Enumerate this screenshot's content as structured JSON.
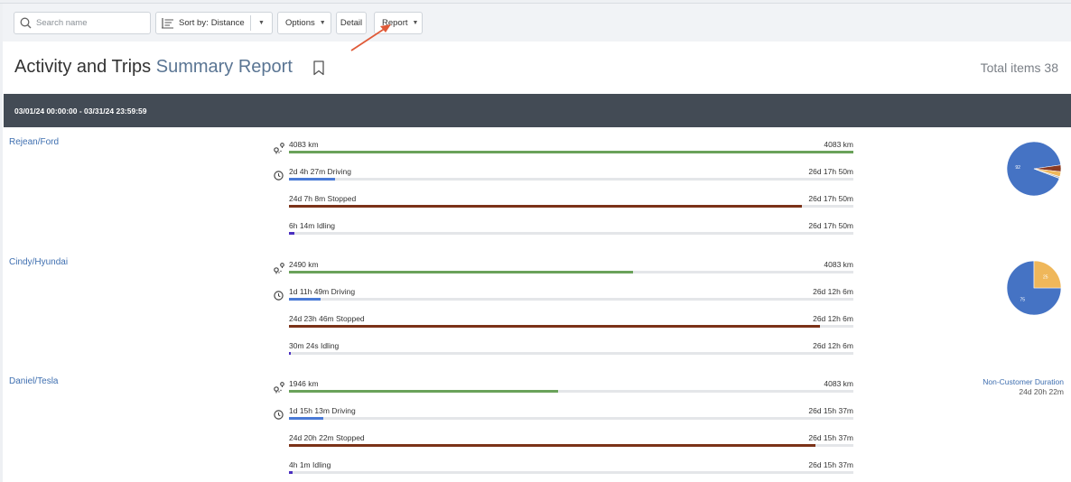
{
  "toolbar": {
    "search_placeholder": "Search name",
    "sort_label": "Sort by:",
    "sort_value": "Distance",
    "options_label": "Options",
    "detail_label": "Detail",
    "report_label": "Report"
  },
  "header": {
    "title_main": "Activity and Trips",
    "title_accent": "Summary Report",
    "total_label": "Total items 38"
  },
  "date_range": "03/01/24 00:00:00 - 03/31/24 23:59:59",
  "colors": {
    "distance": "#6aa25a",
    "driving": "#4a7ad6",
    "stopped": "#7b3218",
    "idling": "#4a2fc0",
    "pie_blue": "#4573c4",
    "pie_orange": "#efb75a",
    "pie_brown": "#8a3a22",
    "pie_gray": "#b0b4bb"
  },
  "items": [
    {
      "name": "Rejean/Ford",
      "metrics": [
        {
          "label": "4083 km",
          "total": "4083 km",
          "fraction": 1.0
        },
        {
          "label": "2d 4h 27m Driving",
          "total": "26d 17h 50m",
          "fraction": 0.082
        },
        {
          "label": "24d 7h 8m Stopped",
          "total": "26d 17h 50m",
          "fraction": 0.908
        },
        {
          "label": "6h 14m Idling",
          "total": "26d 17h 50m",
          "fraction": 0.01
        }
      ],
      "pie": {
        "slices": [
          {
            "value": 92,
            "color": "#4573c4",
            "label": "92"
          },
          {
            "value": 4,
            "color": "#8a3a22",
            "label": ""
          },
          {
            "value": 3,
            "color": "#efb75a",
            "label": ""
          },
          {
            "value": 1,
            "color": "#b0b4bb",
            "label": ""
          }
        ]
      }
    },
    {
      "name": "Cindy/Hyundai",
      "metrics": [
        {
          "label": "2490 km",
          "total": "4083 km",
          "fraction": 0.61
        },
        {
          "label": "1d 11h 49m Driving",
          "total": "26d 12h 6m",
          "fraction": 0.056
        },
        {
          "label": "24d 23h 46m Stopped",
          "total": "26d 12h 6m",
          "fraction": 0.941
        },
        {
          "label": "30m 24s Idling",
          "total": "26d 12h 6m",
          "fraction": 0.002
        }
      ],
      "pie": {
        "slices": [
          {
            "value": 75,
            "color": "#4573c4",
            "label": "75"
          },
          {
            "value": 25,
            "color": "#efb75a",
            "label": "25"
          }
        ]
      }
    },
    {
      "name": "Daniel/Tesla",
      "metrics": [
        {
          "label": "1946 km",
          "total": "4083 km",
          "fraction": 0.477
        },
        {
          "label": "1d 15h 13m Driving",
          "total": "26d 15h 37m",
          "fraction": 0.061
        },
        {
          "label": "24d 20h 22m Stopped",
          "total": "26d 15h 37m",
          "fraction": 0.933
        },
        {
          "label": "4h 1m Idling",
          "total": "26d 15h 37m",
          "fraction": 0.006
        }
      ],
      "non_customer": {
        "label": "Non-Customer Duration",
        "value": "24d 20h 22m"
      }
    }
  ]
}
